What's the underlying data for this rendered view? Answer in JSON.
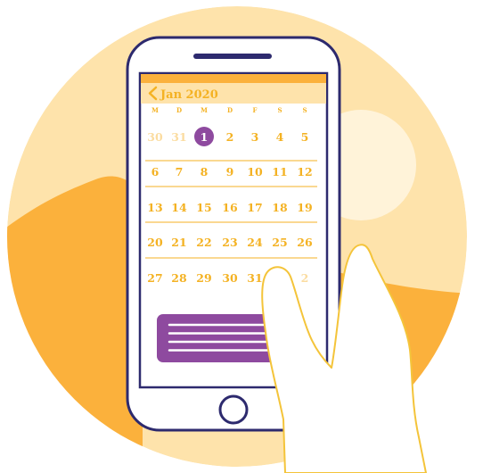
{
  "colors": {
    "background_circle": "#FEE3AB",
    "hill": "#FBB13C",
    "sun": "#FFF3D9",
    "phone_outline": "#2D2A6E",
    "phone_screen": "#FFFFFF",
    "header_bar": "#FBB13C",
    "header_strip": "#FEE3AB",
    "accent": "#8E4A9F",
    "calendar_text": "#F4B223",
    "calendar_faded": "#FBDCA0",
    "hand_fill": "#FFFFFF",
    "hand_outline": "#F4C43A"
  },
  "calendar": {
    "month_label": "Jan 2020",
    "back_icon": "chevron-left-icon",
    "weekdays": [
      "M",
      "D",
      "M",
      "D",
      "F",
      "S",
      "S"
    ],
    "weeks": [
      [
        "30",
        "31",
        "1",
        "2",
        "3",
        "4",
        "5"
      ],
      [
        "6",
        "7",
        "8",
        "9",
        "10",
        "11",
        "12"
      ],
      [
        "13",
        "14",
        "15",
        "16",
        "17",
        "18",
        "19"
      ],
      [
        "20",
        "21",
        "22",
        "23",
        "24",
        "25",
        "26"
      ],
      [
        "27",
        "28",
        "29",
        "30",
        "31",
        "1",
        "2"
      ]
    ],
    "faded_days": [
      [
        0,
        0
      ],
      [
        0,
        1
      ],
      [
        4,
        5
      ],
      [
        4,
        6
      ]
    ],
    "selected_day": [
      0,
      2
    ]
  },
  "event_card": {
    "line_count": 4
  }
}
